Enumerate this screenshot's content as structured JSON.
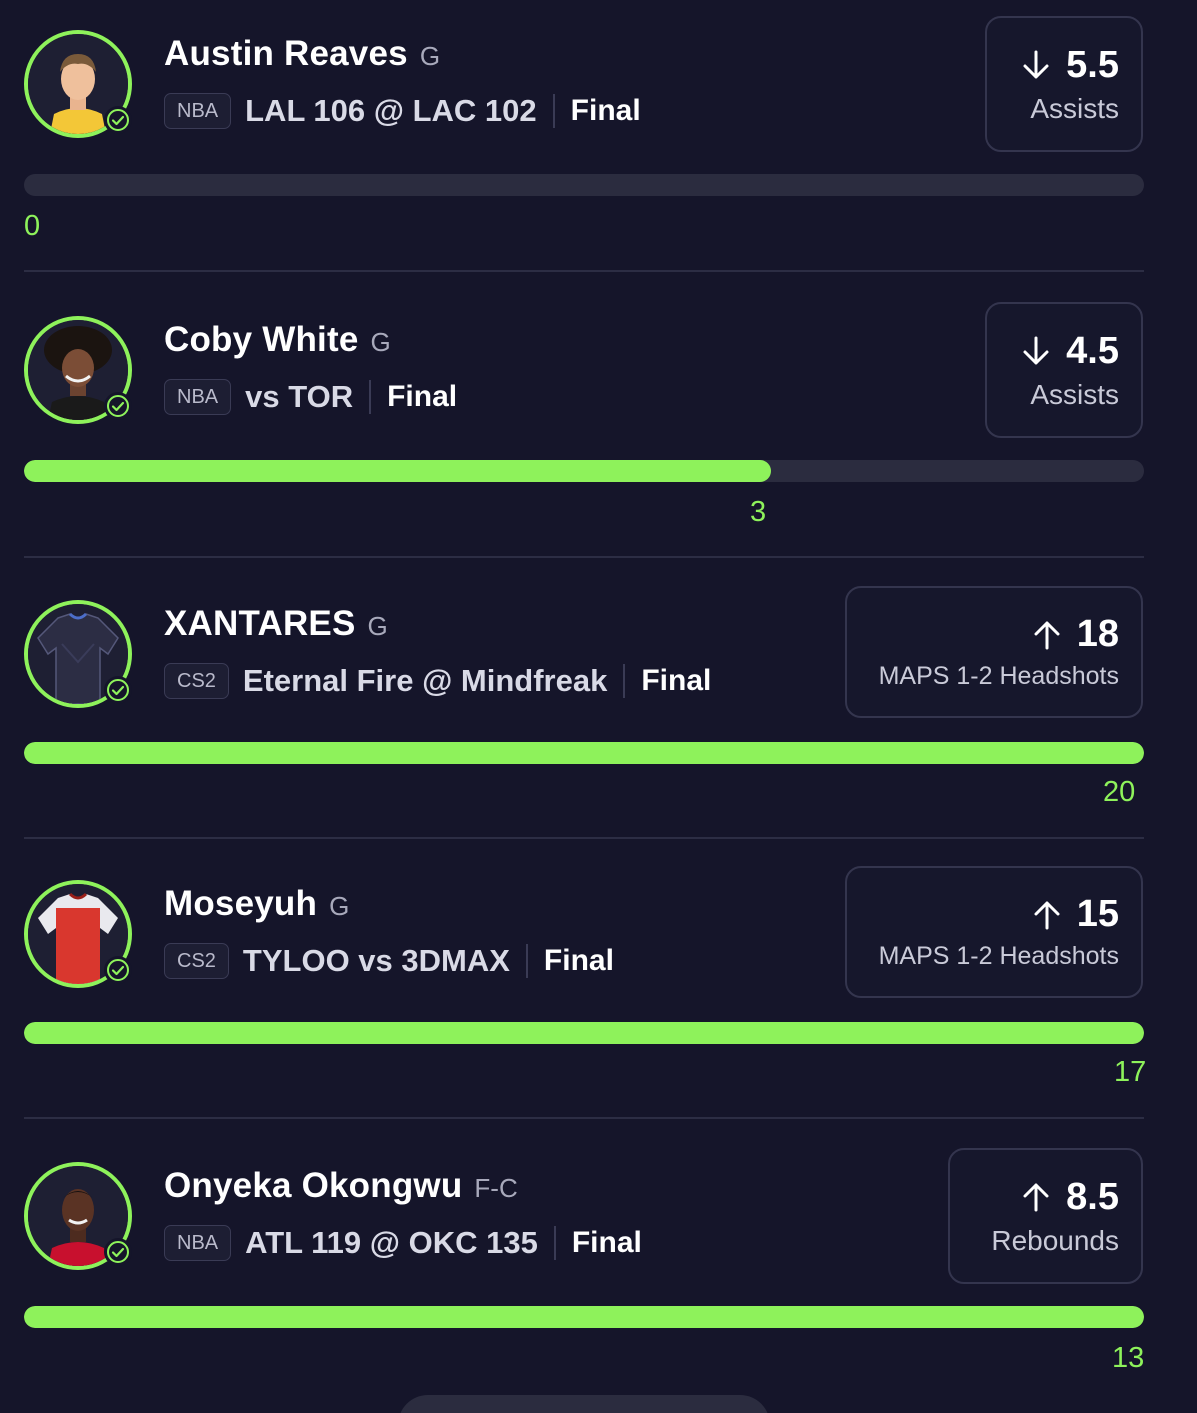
{
  "picks": [
    {
      "player": "Austin Reaves",
      "position": "G",
      "league": "NBA",
      "matchup": "LAL 106 @ LAC 102",
      "status": "Final",
      "direction": "down",
      "direction_icon": "arrow-down-icon",
      "line": "5.5",
      "stat": "Assists",
      "actual": "0",
      "progress": 0,
      "avatar_theme": "lakers"
    },
    {
      "player": "Coby White",
      "position": "G",
      "league": "NBA",
      "matchup": "vs TOR",
      "status": "Final",
      "direction": "down",
      "direction_icon": "arrow-down-icon",
      "line": "4.5",
      "stat": "Assists",
      "actual": "3",
      "progress": 0.667,
      "avatar_theme": "bulls"
    },
    {
      "player": "XANTARES",
      "position": "G",
      "league": "CS2",
      "matchup": "Eternal Fire @ Mindfreak",
      "status": "Final",
      "direction": "up",
      "direction_icon": "arrow-up-icon",
      "line": "18",
      "stat": "MAPS 1-2 Headshots",
      "actual": "20",
      "progress": 1,
      "avatar_theme": "jersey-dark"
    },
    {
      "player": "Moseyuh",
      "position": "G",
      "league": "CS2",
      "matchup": "TYLOO vs 3DMAX",
      "status": "Final",
      "direction": "up",
      "direction_icon": "arrow-up-icon",
      "line": "15",
      "stat": "MAPS 1-2 Headshots",
      "actual": "17",
      "progress": 1,
      "avatar_theme": "jersey-red"
    },
    {
      "player": "Onyeka Okongwu",
      "position": "F-C",
      "league": "NBA",
      "matchup": "ATL 119 @ OKC 135",
      "status": "Final",
      "direction": "up",
      "direction_icon": "arrow-up-icon",
      "line": "8.5",
      "stat": "Rebounds",
      "actual": "13",
      "progress": 1,
      "avatar_theme": "hawks"
    }
  ],
  "colors": {
    "background": "#15152a",
    "accent_green": "#8ef25b",
    "track": "#2b2c3f",
    "divider": "#2c2d44"
  }
}
